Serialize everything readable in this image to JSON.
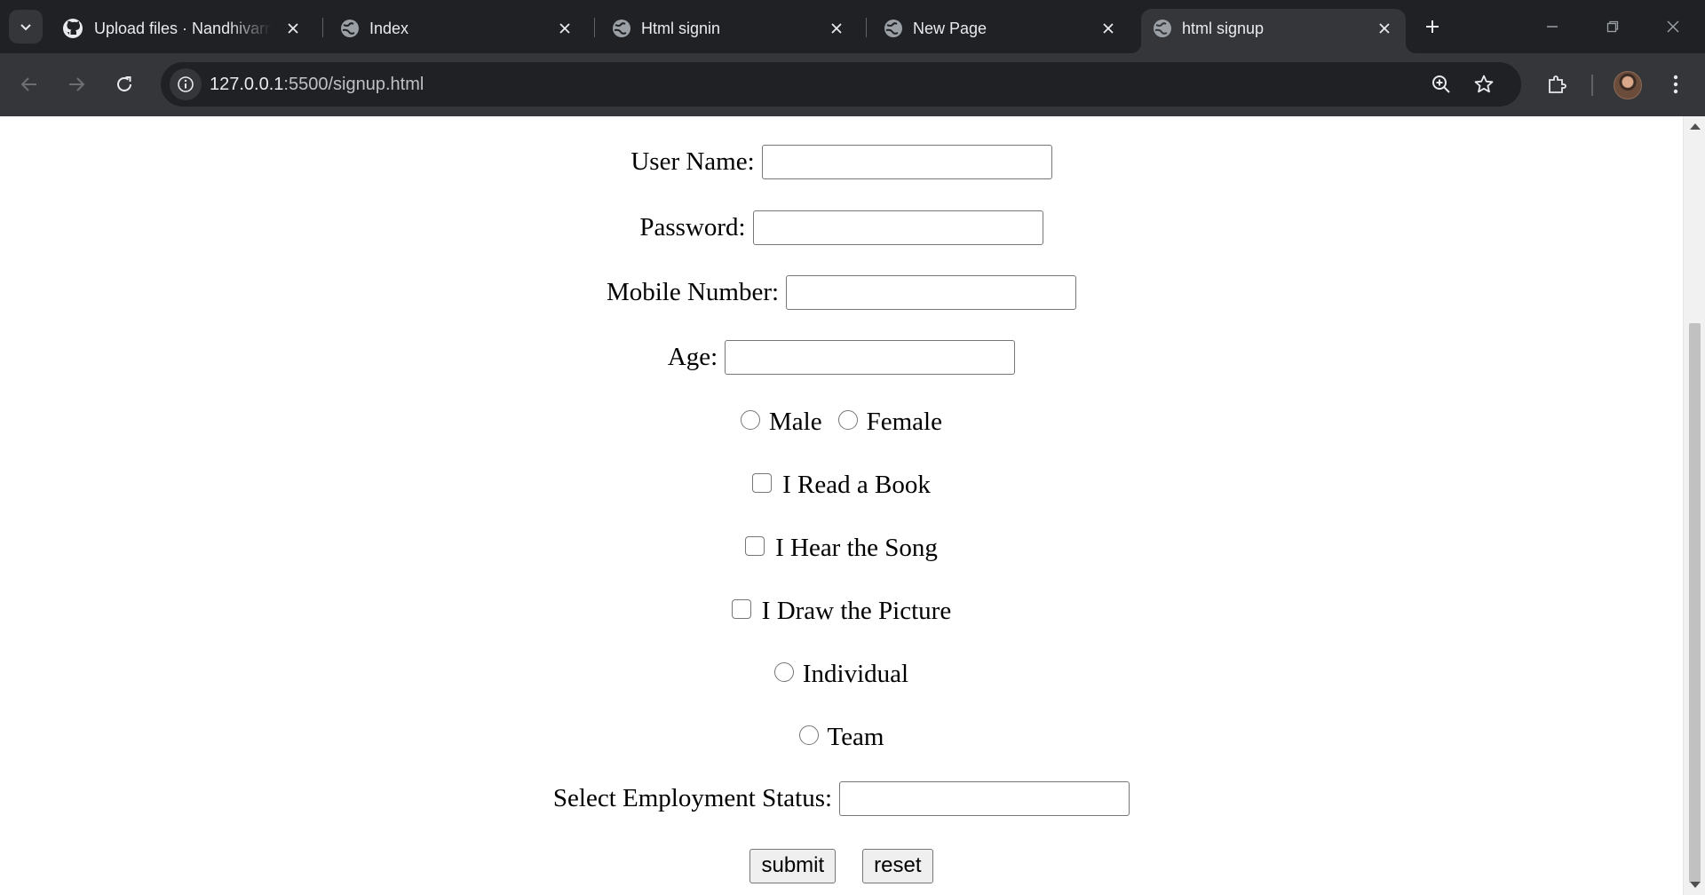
{
  "browser": {
    "tabs": [
      {
        "title": "Upload files · Nandhivarm",
        "icon": "github-icon",
        "active": false
      },
      {
        "title": "Index",
        "icon": "globe-icon",
        "active": false
      },
      {
        "title": "Html signin",
        "icon": "globe-icon",
        "active": false
      },
      {
        "title": "New Page",
        "icon": "globe-icon",
        "active": false
      },
      {
        "title": "html signup",
        "icon": "globe-icon",
        "active": true
      }
    ],
    "url_host": "127.0.0.1",
    "url_path": ":5500/signup.html",
    "colors": {
      "frame": "#202124",
      "toolbar": "#35363a",
      "text": "#e8eaed"
    }
  },
  "form": {
    "fields": [
      {
        "label": "User Name:",
        "value": ""
      },
      {
        "label": "Password:",
        "value": ""
      },
      {
        "label": "Mobile Number:",
        "value": ""
      },
      {
        "label": "Age:",
        "value": ""
      }
    ],
    "gender": {
      "options": [
        "Male",
        "Female"
      ],
      "selected": null
    },
    "hobbies": [
      {
        "label": "I Read a Book",
        "checked": false
      },
      {
        "label": "I Hear the Song",
        "checked": false
      },
      {
        "label": "I Draw the Picture",
        "checked": false
      }
    ],
    "participation": {
      "options": [
        "Individual",
        "Team"
      ],
      "selected": null
    },
    "employment": {
      "label": "Select Employment Status:",
      "value": ""
    },
    "buttons": {
      "submit": "submit",
      "reset": "reset"
    }
  }
}
